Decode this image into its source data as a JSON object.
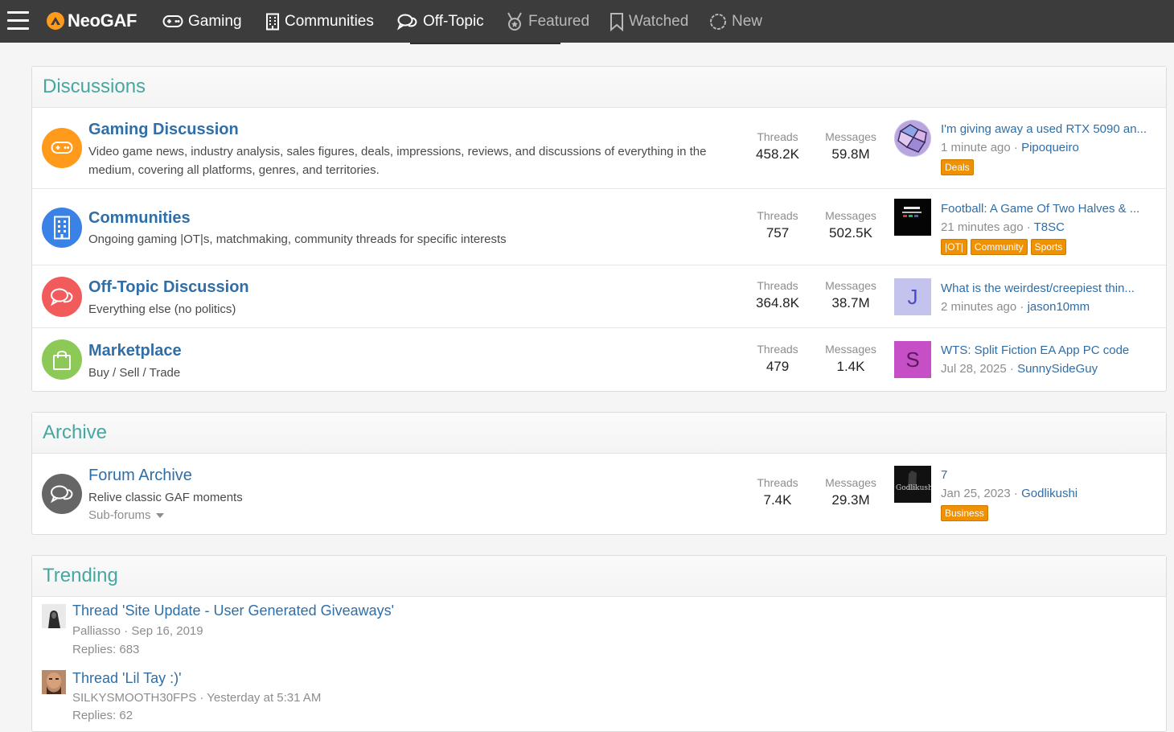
{
  "nav": {
    "logo": "NeoGAF",
    "items": [
      {
        "label": "Gaming",
        "icon": "gamepad-icon"
      },
      {
        "label": "Communities",
        "icon": "building-icon"
      },
      {
        "label": "Off-Topic",
        "icon": "chat-bubbles-icon"
      },
      {
        "label": "Featured",
        "icon": "medal-icon"
      },
      {
        "label": "Watched",
        "icon": "bookmark-icon"
      },
      {
        "label": "New",
        "icon": "circle-icon"
      }
    ]
  },
  "discussions": {
    "title": "Discussions",
    "nodes": [
      {
        "title": "Gaming Discussion",
        "description": "Video game news, industry analysis, sales figures, deals, impressions, reviews, and discussions of everything in the medium, covering all platforms, genres, and territories.",
        "threads_label": "Threads",
        "threads": "458.2K",
        "messages_label": "Messages",
        "messages": "59.8M",
        "last_title": "I'm giving away a used RTX 5090 an...",
        "last_time": "1 minute ago",
        "last_user": "Pipoqueiro",
        "tags": [
          "Deals"
        ],
        "icon_color": "#ff9a1a",
        "icon": "gamepad-icon"
      },
      {
        "title": "Communities",
        "description": "Ongoing gaming |OT|s, matchmaking, community threads for specific interests",
        "threads_label": "Threads",
        "threads": "757",
        "messages_label": "Messages",
        "messages": "502.5K",
        "last_title": "Football: A Game Of Two Halves & ...",
        "last_time": "21 minutes ago",
        "last_user": "T8SC",
        "tags": [
          "|OT|",
          "Community",
          "Sports"
        ],
        "icon_color": "#3b82e6",
        "icon": "building-icon"
      },
      {
        "title": "Off-Topic Discussion",
        "description": "Everything else (no politics)",
        "threads_label": "Threads",
        "threads": "364.8K",
        "messages_label": "Messages",
        "messages": "38.7M",
        "last_title": "What is the weirdest/creepiest thin...",
        "last_time": "2 minutes ago",
        "last_user": "jason10mm",
        "tags": [],
        "avatar_letter": "J",
        "icon_color": "#f25b5b",
        "icon": "chat-bubbles-icon"
      },
      {
        "title": "Marketplace",
        "description": "Buy / Sell / Trade",
        "threads_label": "Threads",
        "threads": "479",
        "messages_label": "Messages",
        "messages": "1.4K",
        "last_title": "WTS: Split Fiction EA App PC code",
        "last_time": "Jul 28, 2025",
        "last_user": "SunnySideGuy",
        "tags": [],
        "avatar_letter": "S",
        "icon_color": "#8cc957",
        "icon": "shopping-bag-icon"
      }
    ]
  },
  "archive": {
    "title": "Archive",
    "node": {
      "title": "Forum Archive",
      "description": "Relive classic GAF moments",
      "sub_forums": "Sub-forums",
      "threads_label": "Threads",
      "threads": "7.4K",
      "messages_label": "Messages",
      "messages": "29.3M",
      "last_title": "7",
      "last_time": "Jan 25, 2023",
      "last_user": "Godlikushi",
      "tags": [
        "Business"
      ],
      "avatar_text": "Godlikushi"
    }
  },
  "trending": {
    "title": "Trending",
    "items": [
      {
        "title": "Thread 'Site Update - User Generated Giveaways'",
        "meta": "Palliasso · Sep 16, 2019",
        "replies": "Replies: 683"
      },
      {
        "title": "Thread 'Lil Tay :)'",
        "meta": "SILKYSMOOTH30FPS · Yesterday at 5:31 AM",
        "replies": "Replies: 62"
      }
    ]
  }
}
